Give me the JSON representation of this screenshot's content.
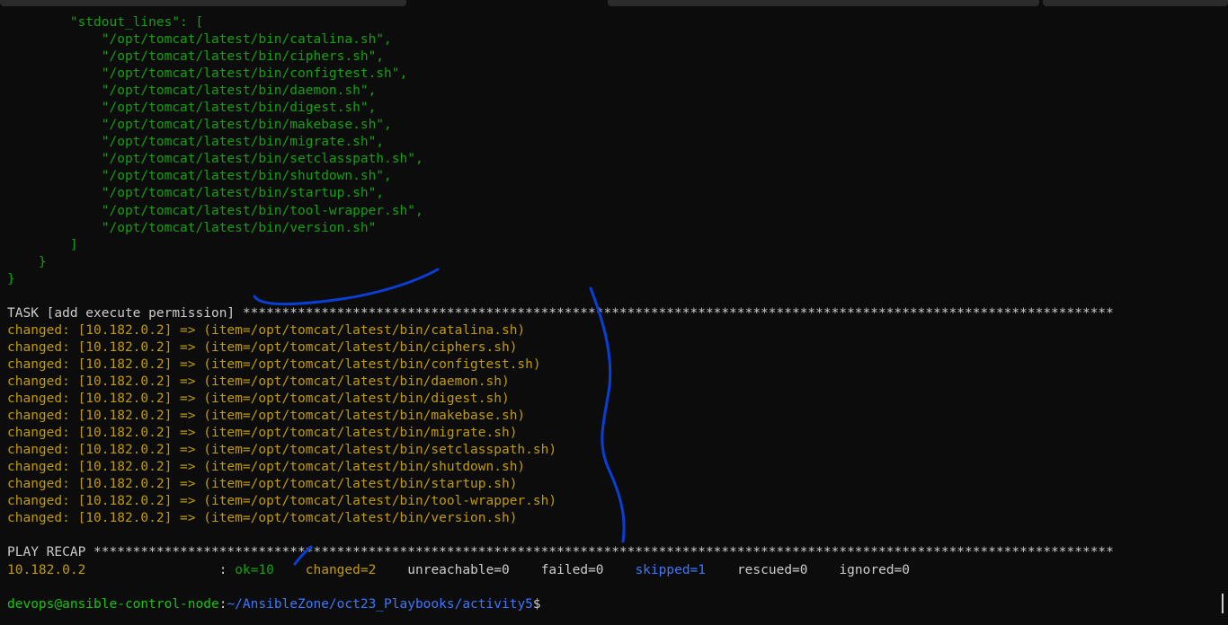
{
  "terminal": {
    "json_output": {
      "key_line": "        \"stdout_lines\": [",
      "items": [
        "            \"/opt/tomcat/latest/bin/catalina.sh\",",
        "            \"/opt/tomcat/latest/bin/ciphers.sh\",",
        "            \"/opt/tomcat/latest/bin/configtest.sh\",",
        "            \"/opt/tomcat/latest/bin/daemon.sh\",",
        "            \"/opt/tomcat/latest/bin/digest.sh\",",
        "            \"/opt/tomcat/latest/bin/makebase.sh\",",
        "            \"/opt/tomcat/latest/bin/migrate.sh\",",
        "            \"/opt/tomcat/latest/bin/setclasspath.sh\",",
        "            \"/opt/tomcat/latest/bin/shutdown.sh\",",
        "            \"/opt/tomcat/latest/bin/startup.sh\",",
        "            \"/opt/tomcat/latest/bin/tool-wrapper.sh\",",
        "            \"/opt/tomcat/latest/bin/version.sh\""
      ],
      "close_bracket": "        ]",
      "close_inner": "    }",
      "close_outer": "}"
    },
    "task_header": "TASK [add execute permission] ***************************************************************************************************************",
    "task_lines": [
      "changed: [10.182.0.2] => (item=/opt/tomcat/latest/bin/catalina.sh)",
      "changed: [10.182.0.2] => (item=/opt/tomcat/latest/bin/ciphers.sh)",
      "changed: [10.182.0.2] => (item=/opt/tomcat/latest/bin/configtest.sh)",
      "changed: [10.182.0.2] => (item=/opt/tomcat/latest/bin/daemon.sh)",
      "changed: [10.182.0.2] => (item=/opt/tomcat/latest/bin/digest.sh)",
      "changed: [10.182.0.2] => (item=/opt/tomcat/latest/bin/makebase.sh)",
      "changed: [10.182.0.2] => (item=/opt/tomcat/latest/bin/migrate.sh)",
      "changed: [10.182.0.2] => (item=/opt/tomcat/latest/bin/setclasspath.sh)",
      "changed: [10.182.0.2] => (item=/opt/tomcat/latest/bin/shutdown.sh)",
      "changed: [10.182.0.2] => (item=/opt/tomcat/latest/bin/startup.sh)",
      "changed: [10.182.0.2] => (item=/opt/tomcat/latest/bin/tool-wrapper.sh)",
      "changed: [10.182.0.2] => (item=/opt/tomcat/latest/bin/version.sh)"
    ],
    "recap_header": "PLAY RECAP **********************************************************************************************************************************",
    "recap": {
      "host": "10.182.0.2",
      "separator": "                 : ",
      "ok": "ok=10",
      "changed": "changed=2",
      "unreachable": "unreachable=0",
      "failed": "failed=0",
      "skipped": "skipped=1",
      "rescued": "rescued=0",
      "ignored": "ignored=0"
    },
    "prompt": {
      "user_host": "devops@ansible-control-node",
      "colon": ":",
      "path": "~/AnsibleZone/oct23_Playbooks/activity5",
      "symbol": "$"
    }
  },
  "colors": {
    "background": "#0c0c0c",
    "json_green": "#13a10e",
    "changed_yellow": "#c19c00",
    "header_white": "#cccccc",
    "skipped_blue": "#3b78ff",
    "annotation_blue": "#0a3fd6"
  }
}
